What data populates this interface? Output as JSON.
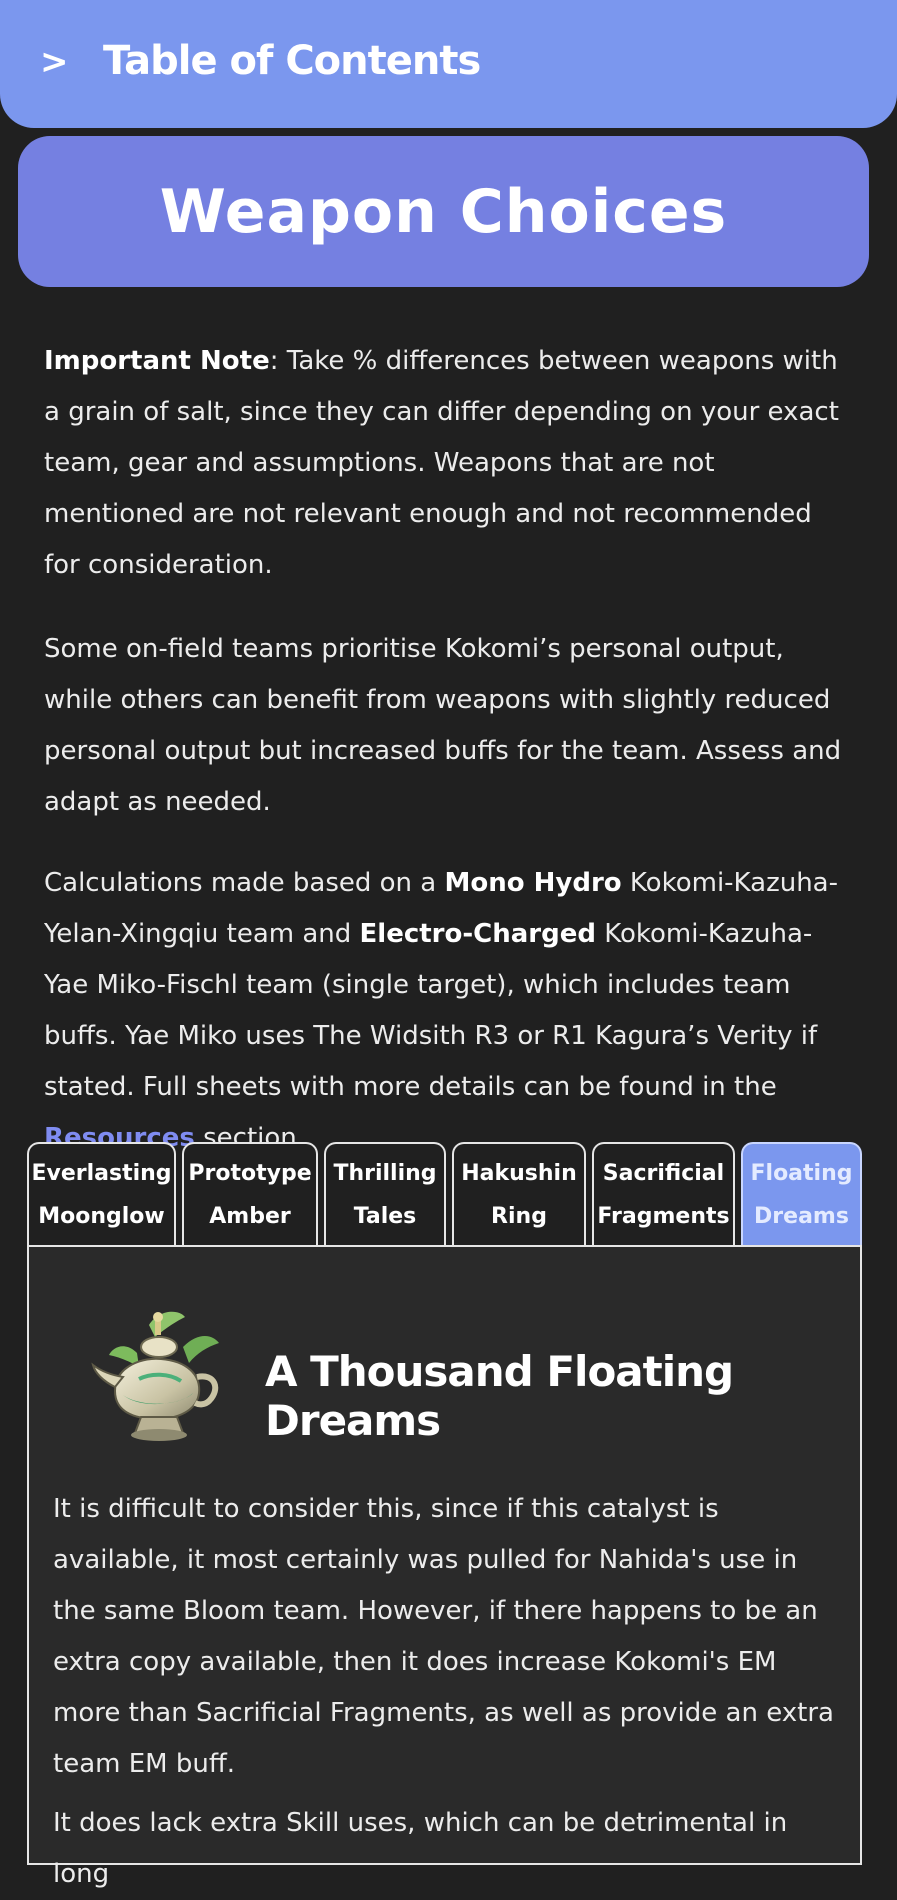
{
  "toc": {
    "chevron": ">",
    "title": "Table of Contents"
  },
  "section": {
    "title": "Weapon Choices"
  },
  "intro": {
    "note_label": "Important Note",
    "note_text": ": Take % differences between weapons with a grain of salt, since they can differ depending on your exact team, gear and assumptions. Weapons that are not mentioned are not relevant enough and not recommended for consideration.",
    "paragraph2": "Some on-field teams prioritise Kokomi’s personal output, while others can benefit from weapons with slightly reduced personal output but increased buffs for the team. Assess and adapt as needed.",
    "calc_part1": "Calculations made based on a ",
    "calc_bold1": "Mono Hydro",
    "calc_part2": " Kokomi-Kazuha-Yelan-Xingqiu team and ",
    "calc_bold2": "Electro-Charged",
    "calc_part3": " Kokomi-Kazuha-Yae Miko-Fischl team (single target), which includes team buffs. Yae Miko uses The Widsith R3 or R1 Kagura’s Verity if stated. Full sheets with more details can be found in the ",
    "calc_link": "Resources",
    "calc_part4": " section."
  },
  "tabs": [
    {
      "line1": "Everlasting",
      "line2": "Moonglow"
    },
    {
      "line1": "Prototype",
      "line2": "Amber"
    },
    {
      "line1": "Thrilling",
      "line2": "Tales"
    },
    {
      "line1": "Hakushin",
      "line2": "Ring"
    },
    {
      "line1": "Sacrificial",
      "line2": "Fragments"
    },
    {
      "line1": "Floating",
      "line2": "Dreams"
    }
  ],
  "active_tab": "Floating Dreams",
  "weapon": {
    "name": "A Thousand Floating Dreams",
    "icon": "lamp-catalyst-icon",
    "paragraph1": "It is difficult to consider this, since if this catalyst is available, it most certainly was pulled for Nahida's use in the same Bloom team. However, if there happens to be an extra copy available, then it does increase Kokomi's EM more than Sacrificial Fragments, as well as provide an extra team EM buff.",
    "paragraph2": "It does lack extra Skill uses, which can be detrimental in long"
  },
  "colors": {
    "background": "#202020",
    "toc_bar": "#7b97ee",
    "banner": "#7580e1",
    "link": "#7f8cf1",
    "panel": "#2a2a2a"
  }
}
